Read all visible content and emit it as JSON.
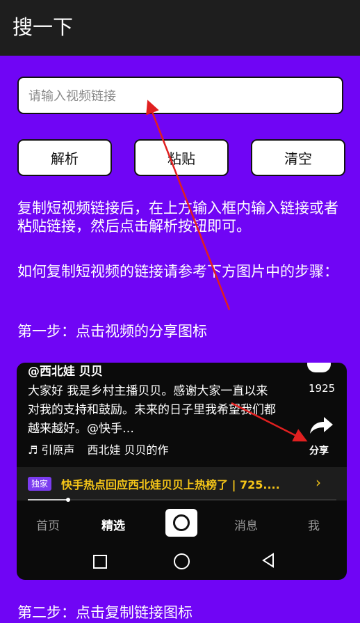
{
  "appbar": {
    "title": "搜一下"
  },
  "search": {
    "placeholder": "请输入视频链接",
    "value": ""
  },
  "buttons": {
    "parse": "解析",
    "paste": "粘贴",
    "clear": "清空"
  },
  "instructions": {
    "line1": "复制短视频链接后，在上方输入框内输入链接或者粘贴链接，然后点击解析按钮即可。",
    "line2": "如何复制短视频的链接请参考下方图片中的步骤：",
    "step1": "第一步：点击视频的分享图标",
    "step2": "第二步：点击复制链接图标"
  },
  "screenshot": {
    "author": "@西北娃 贝贝",
    "description": "大家好 我是乡村主播贝贝。感谢大家一直以来对我的支持和鼓励。未来的日子里我希望我们都越来越好。@快手…",
    "music_prefix": "♬ 引原声",
    "music_name": "西北娃 贝贝的作",
    "comment_count": "1925",
    "share_label": "分享",
    "badge": "独家",
    "banner_text": "快手热点回应西北娃贝贝上热榜了 | 725....",
    "banner_chevron": "›",
    "progress_fraction": 0.13,
    "tabs": {
      "home": "首页",
      "featured": "精选",
      "messages": "消息",
      "me": "我"
    }
  },
  "colors": {
    "background": "#7005f5",
    "appbar": "#1e1e1e",
    "arrow": "#e02020",
    "banner_text": "#f5c518",
    "badge": "#7b3cf0"
  }
}
